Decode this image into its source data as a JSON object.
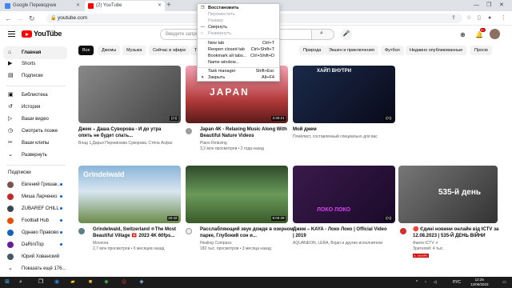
{
  "browser": {
    "tabs": [
      {
        "label": "Google Переводчик"
      },
      {
        "label": "(2) YouTube"
      }
    ],
    "new_tab": "+",
    "url": "youtube.com"
  },
  "context_menu": {
    "items": [
      {
        "label": "Восстановить",
        "shortcut": "",
        "disabled": false,
        "bold": true
      },
      {
        "label": "Переместить",
        "shortcut": "",
        "disabled": true
      },
      {
        "label": "Размер",
        "shortcut": "",
        "disabled": true
      },
      {
        "label": "Свернуть",
        "shortcut": "",
        "disabled": false
      },
      {
        "label": "Развернуть",
        "shortcut": "",
        "disabled": true
      },
      {
        "label": "New tab",
        "shortcut": "Ctrl+T",
        "disabled": false
      },
      {
        "label": "Reopen closed tab",
        "shortcut": "Ctrl+Shift+T",
        "disabled": false
      },
      {
        "label": "Bookmark all tabs...",
        "shortcut": "Ctrl+Shift+D",
        "disabled": false
      },
      {
        "label": "Name window...",
        "shortcut": "",
        "disabled": false
      },
      {
        "label": "Task manager",
        "shortcut": "Shift+Esc",
        "disabled": false
      },
      {
        "label": "Закрыть",
        "shortcut": "Alt+F4",
        "disabled": false
      }
    ]
  },
  "youtube": {
    "logo_text": "YouTube",
    "country": "UA",
    "search_placeholder": "Введите запрос",
    "notifications": "9+"
  },
  "sidebar": {
    "main": [
      {
        "label": "Главная",
        "icon": "home-icon"
      },
      {
        "label": "Shorts",
        "icon": "shorts-icon"
      },
      {
        "label": "Подписки",
        "icon": "subscriptions-icon"
      }
    ],
    "library": [
      {
        "label": "Библиотека",
        "icon": "library-icon"
      },
      {
        "label": "История",
        "icon": "history-icon"
      },
      {
        "label": "Ваши видео",
        "icon": "your-videos-icon"
      },
      {
        "label": "Смотреть позже",
        "icon": "watch-later-icon"
      },
      {
        "label": "Ваши клипы",
        "icon": "clips-icon"
      },
      {
        "label": "Развернуть",
        "icon": "chevron-down-icon"
      }
    ],
    "subs_heading": "Подписки",
    "subs": [
      {
        "label": "Евгений Гришак...",
        "color": "#795548"
      },
      {
        "label": "Миша Ларченко",
        "color": "#c62828"
      },
      {
        "label": "ZUBAREF CHILL",
        "color": "#37474f"
      },
      {
        "label": "Football Hub",
        "color": "#e65100"
      },
      {
        "label": "Однако Правово",
        "color": "#1565c0"
      },
      {
        "label": "DaRiniTop",
        "color": "#6a1b9a"
      },
      {
        "label": "Юрий Хованский",
        "color": "#455a64"
      }
    ],
    "show_more": "Показать ещё 176..."
  },
  "chips": [
    "Все",
    "Джемы",
    "Музыка",
    "Сейчас в эфире",
    "Т",
    "Природа",
    "Экшен и приключения",
    "Футбол",
    "Недавно опубликованные",
    "Просм"
  ],
  "videos": [
    {
      "title": "Джем – Даша Суворова - И до утра опять не будет спать...",
      "channel": "Влад Лазарев",
      "meta": "Влад 1,Дарья Перевёзова Суворова, Стёпа Асфальта и другие исполнители",
      "duration": "",
      "thumb_color": "#6a6a6a"
    },
    {
      "title": "Japan 4K - Relaxing Music Along With Beautiful Nature Videos",
      "channel": "Piano Relaxing",
      "meta": "3,2 млн просмотров • 2 года назад",
      "duration": "3:30:21",
      "thumb_color": "#b23a3a",
      "thumb_text": "JAPAN"
    },
    {
      "title": "Мой джем",
      "channel": "",
      "meta": "Плейлист, составленный специально для вас",
      "duration": "",
      "thumb_color": "#333",
      "thumb_text": "ХАЙП ВНУТРИ"
    },
    {
      "title": "Grindelwald, Switzerland ❄The Most Beautiful Village 🇨🇭 2023 4K 60fps...",
      "channel": "Moveora",
      "meta": "2,7 млн просмотров • 6 месяцев назад",
      "duration": "20:42",
      "thumb_color": "#8ab4d8",
      "thumb_text": "Grindelwald"
    },
    {
      "title": "Расслабляющий звук дождя в озерном парке, Глубокий сон и...",
      "channel": "Healing Compass",
      "meta": "182 тыс. просмотров • 3 месяца назад",
      "duration": "8:00:29",
      "thumb_color": "#4a7c3f"
    },
    {
      "title": "Джем – KAYA - Локо Локо | Official Video | 2019",
      "channel": "AQUANEON, LERA, Bojan и другие исполнители",
      "meta": "",
      "duration": "",
      "thumb_color": "#2a1a3a",
      "thumb_text": "ЛОКО ЛОКО"
    },
    {
      "title": "🔴 Єдині новини онлайн від ICTV за 12.08.2023 | 535-Й ДЕНЬ ВІЙНИ",
      "channel": "Факти ICTV ✔",
      "meta": "Зрителей: 4 тыс.",
      "live": "В ЭФИРЕ",
      "duration": "",
      "thumb_color": "#555",
      "thumb_text": "535-й день"
    }
  ],
  "taskbar": {
    "lang": "РУС",
    "time": "12:25",
    "date": "12/08/2023"
  }
}
